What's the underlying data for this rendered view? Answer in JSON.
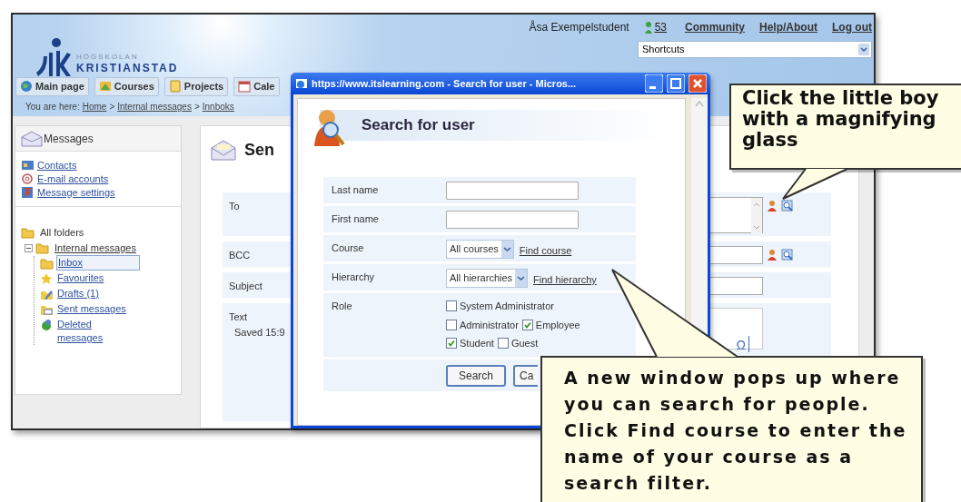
{
  "header": {
    "logo_small": "HÖGSKOLAN",
    "logo_large": "KRISTIANSTAD",
    "user": "Åsa Exempelstudent",
    "points": "53",
    "links": [
      "Community",
      "Help/About",
      "Log out"
    ],
    "shortcuts": "Shortcuts"
  },
  "nav_tabs": [
    {
      "label": "Main page"
    },
    {
      "label": "Courses"
    },
    {
      "label": "Projects"
    },
    {
      "label": "Cale"
    }
  ],
  "breadcrumb": [
    {
      "kind": "prefix",
      "text": "You are here:"
    },
    {
      "kind": "link",
      "text": "Home"
    },
    {
      "kind": "separator",
      "text": ">"
    },
    {
      "kind": "link",
      "text": "Internal messages"
    },
    {
      "kind": "separator",
      "text": ">"
    },
    {
      "kind": "link",
      "text": "Innboks"
    }
  ],
  "sidebar": {
    "title": "Messages",
    "links": [
      "Contacts",
      "E-mail accounts",
      "Message settings"
    ],
    "tree": {
      "label": "All folders",
      "children": [
        {
          "label": "Internal messages",
          "expanded": true,
          "children": [
            {
              "label": "Inbox",
              "selected": true
            },
            {
              "label": "Favourites",
              "selected": false
            },
            {
              "label": "Drafts (1)",
              "selected": false
            },
            {
              "label": "Sent messages",
              "selected": false
            },
            {
              "label": "Deleted messages",
              "selected": false
            }
          ]
        }
      ]
    }
  },
  "compose": {
    "heading": "Sen",
    "fields": [
      {
        "kind": "address_area",
        "label": "To"
      },
      {
        "kind": "address_line",
        "label": "BCC"
      },
      {
        "kind": "line",
        "label": "Subject"
      },
      {
        "kind": "editor",
        "label": "Text",
        "note": "Saved 15:9",
        "toolbar": "Ω"
      }
    ]
  },
  "popup": {
    "title": "https://www.itslearning.com - Search for user - Micros...",
    "heading": "Search for user",
    "fields": [
      {
        "kind": "text",
        "label": "Last name"
      },
      {
        "kind": "text",
        "label": "First name"
      },
      {
        "kind": "select",
        "label": "Course",
        "value": "All courses",
        "link": "Find course"
      },
      {
        "kind": "select",
        "label": "Hierarchy",
        "value": "All hierarchies",
        "link": "Find hierarchy"
      },
      {
        "kind": "checks",
        "label": "Role",
        "options": [
          {
            "label": "System Administrator",
            "checked": false
          },
          {
            "label": "Administrator",
            "checked": false
          },
          {
            "label": "Employee",
            "checked": true
          },
          {
            "label": "Student",
            "checked": true
          },
          {
            "label": "Guest",
            "checked": false
          }
        ]
      }
    ],
    "buttons": [
      "Search",
      "Ca"
    ]
  },
  "callouts": [
    {
      "text": "Click the little boy with a magnifying glass"
    },
    {
      "text": "A new window pops up where you can search for people. Click Find course to enter the name of your course as a search filter."
    }
  ]
}
